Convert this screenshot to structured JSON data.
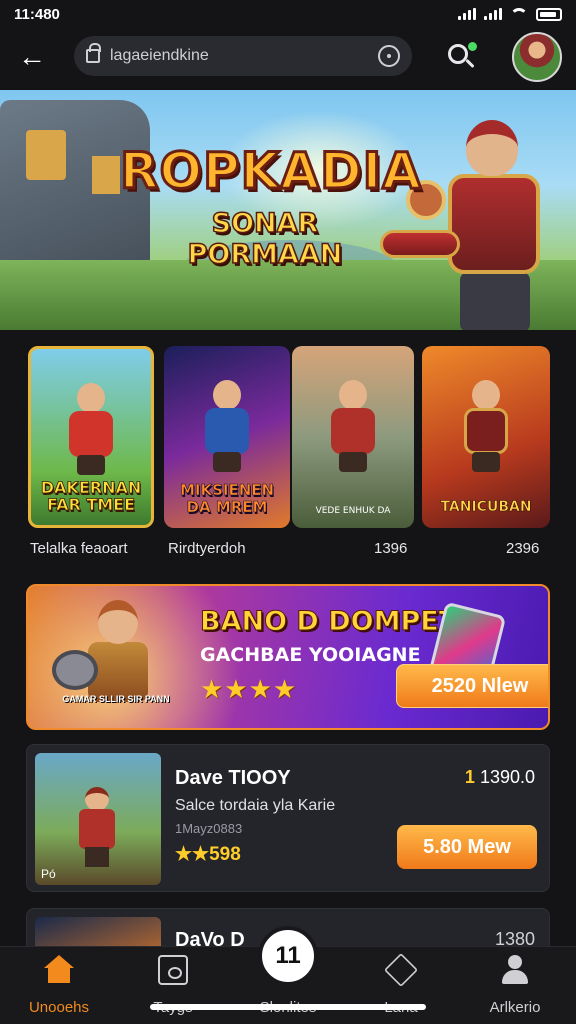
{
  "status_bar": {
    "time": "11:480"
  },
  "header": {
    "back_label": "←",
    "url": "lagaeiendkine"
  },
  "hero": {
    "title": "ROPKADIA",
    "subtitle": "SONAR PORMAAN"
  },
  "tiles": [
    {
      "art_title": "DAKERNAN\nFAR TMEE",
      "caption": "Telalka feaoart"
    },
    {
      "art_title": "MIKSIENEN\nDA MREM",
      "caption": "Rirdtyerdoh"
    },
    {
      "art_title": "VEDE   ENHUK   DA",
      "caption": "1396"
    },
    {
      "art_title": "TANICUBAN",
      "caption": "2396"
    }
  ],
  "promo": {
    "title": "BANO D DOMPET!",
    "subtitle": "GACHBAE YOOIAGNE",
    "stars": "★★★★",
    "hero_caption": "GAMAR SLLIR SIR PANN",
    "button_label": "2520 Nlew"
  },
  "list": [
    {
      "name": "Dave TIOOY",
      "price": "1390.0",
      "price_prefix": "1 ",
      "desc": "Salce tordaia yla Karie",
      "meta": "1Mayz0883",
      "rating": "★★598",
      "thumb_badge": "Pó",
      "button_label": "5.80 Mew"
    },
    {
      "name": "DaVo D",
      "price": "1380"
    }
  ],
  "tabbar": {
    "tabs": [
      {
        "label": "Unooehs"
      },
      {
        "label": "Taygs"
      },
      {
        "label": "Slonlites"
      },
      {
        "label": "Lana"
      },
      {
        "label": "Arlkerio"
      }
    ],
    "fab_label": "11"
  },
  "colors": {
    "accent": "#f28a1e",
    "background": "#141416",
    "card": "#24252a"
  }
}
